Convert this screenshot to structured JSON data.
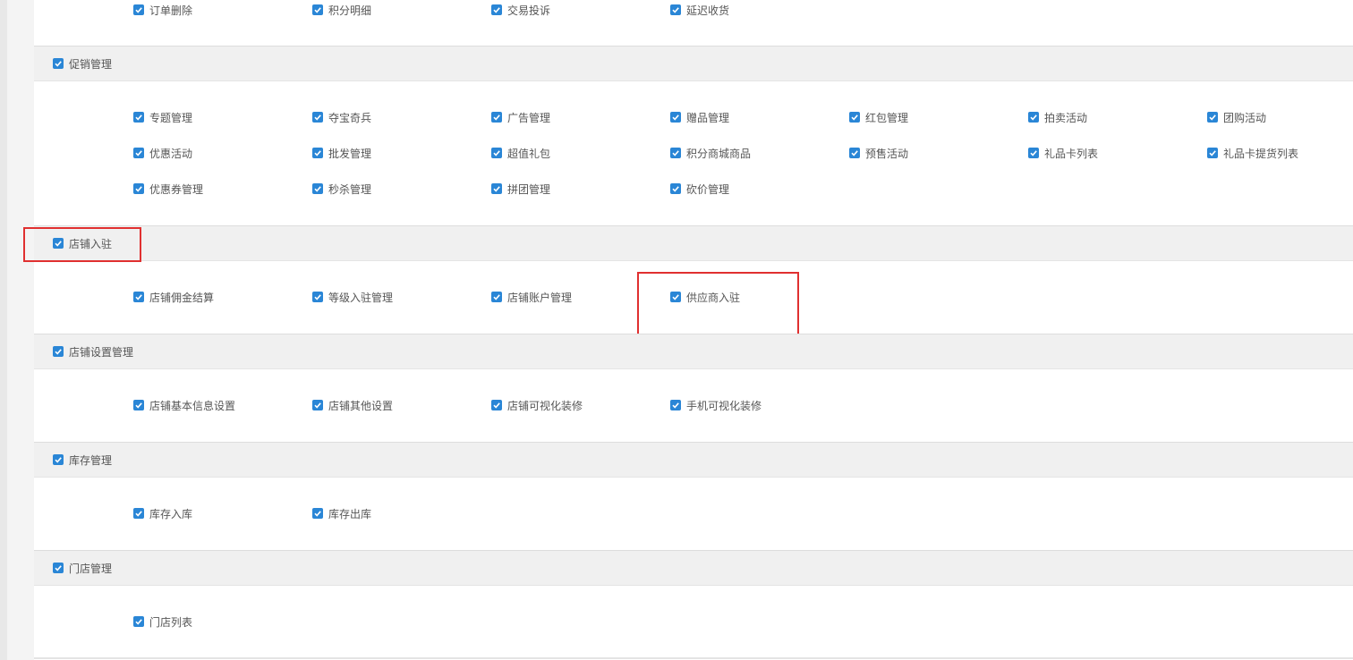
{
  "accent_color": "#2a86d6",
  "highlight_color": "#e03030",
  "checkbox_icon": "checked-checkbox-icon",
  "sections": [
    {
      "id": "order",
      "title": "",
      "checked": true,
      "items": [
        {
          "label": "订单删除",
          "checked": true
        },
        {
          "label": "积分明细",
          "checked": true
        },
        {
          "label": "交易投诉",
          "checked": true
        },
        {
          "label": "延迟收货",
          "checked": true
        }
      ]
    },
    {
      "id": "promotion",
      "title": "促销管理",
      "checked": true,
      "items": [
        {
          "label": "专题管理",
          "checked": true
        },
        {
          "label": "夺宝奇兵",
          "checked": true
        },
        {
          "label": "广告管理",
          "checked": true
        },
        {
          "label": "赠品管理",
          "checked": true
        },
        {
          "label": "红包管理",
          "checked": true
        },
        {
          "label": "拍卖活动",
          "checked": true
        },
        {
          "label": "团购活动",
          "checked": true
        },
        {
          "label": "优惠活动",
          "checked": true
        },
        {
          "label": "批发管理",
          "checked": true
        },
        {
          "label": "超值礼包",
          "checked": true
        },
        {
          "label": "积分商城商品",
          "checked": true
        },
        {
          "label": "预售活动",
          "checked": true
        },
        {
          "label": "礼品卡列表",
          "checked": true
        },
        {
          "label": "礼品卡提货列表",
          "checked": true
        },
        {
          "label": "优惠券管理",
          "checked": true
        },
        {
          "label": "秒杀管理",
          "checked": true
        },
        {
          "label": "拼团管理",
          "checked": true
        },
        {
          "label": "砍价管理",
          "checked": true
        }
      ]
    },
    {
      "id": "store-entry",
      "title": "店铺入驻",
      "checked": true,
      "items": [
        {
          "label": "店铺佣金结算",
          "checked": true
        },
        {
          "label": "等级入驻管理",
          "checked": true
        },
        {
          "label": "店铺账户管理",
          "checked": true
        },
        {
          "label": "供应商入驻",
          "checked": true
        }
      ]
    },
    {
      "id": "store-settings",
      "title": "店铺设置管理",
      "checked": true,
      "items": [
        {
          "label": "店铺基本信息设置",
          "checked": true
        },
        {
          "label": "店铺其他设置",
          "checked": true
        },
        {
          "label": "店铺可视化装修",
          "checked": true
        },
        {
          "label": "手机可视化装修",
          "checked": true
        }
      ]
    },
    {
      "id": "inventory",
      "title": "库存管理",
      "checked": true,
      "items": [
        {
          "label": "库存入库",
          "checked": true
        },
        {
          "label": "库存出库",
          "checked": true
        }
      ]
    },
    {
      "id": "stores",
      "title": "门店管理",
      "checked": true,
      "items": [
        {
          "label": "门店列表",
          "checked": true
        }
      ]
    }
  ]
}
